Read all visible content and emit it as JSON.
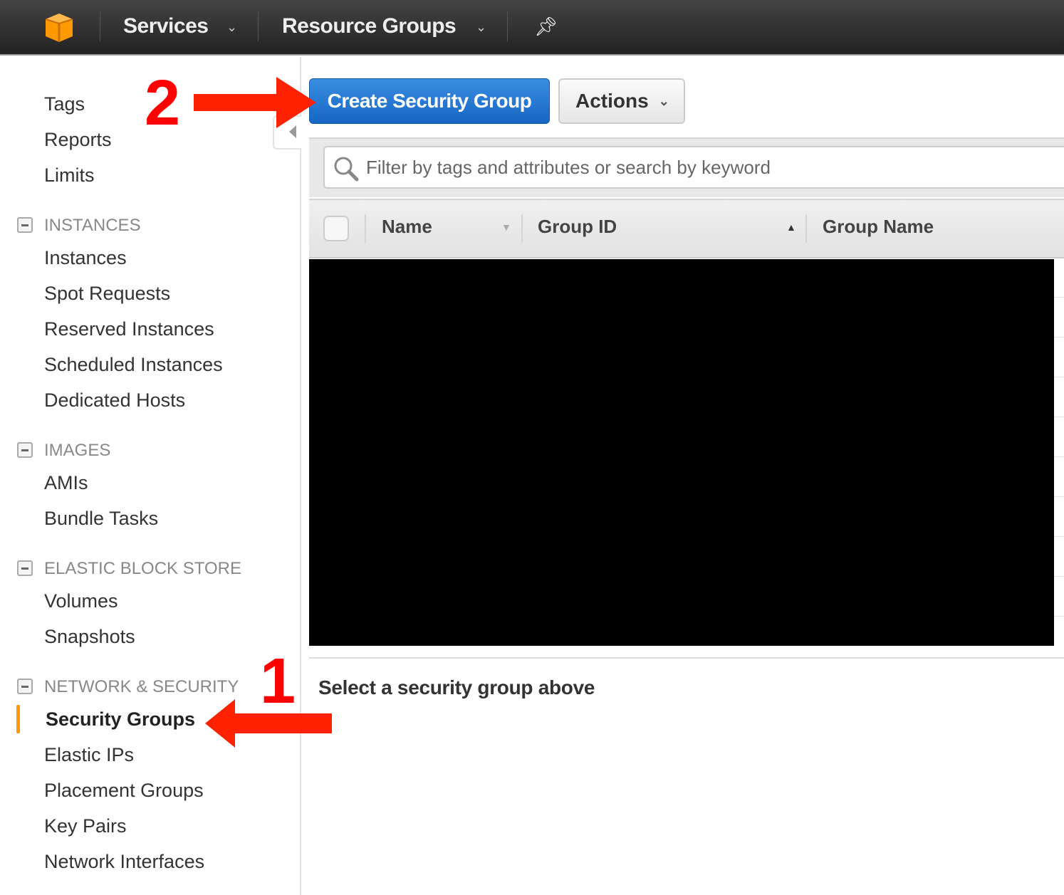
{
  "topbar": {
    "logo": "aws-cube-logo",
    "services_label": "Services",
    "resource_groups_label": "Resource Groups",
    "pin_icon": "pin-icon"
  },
  "sidebar": {
    "top_items": [
      "Tags",
      "Reports",
      "Limits"
    ],
    "sections": [
      {
        "header": "INSTANCES",
        "items": [
          "Instances",
          "Spot Requests",
          "Reserved Instances",
          "Scheduled Instances",
          "Dedicated Hosts"
        ]
      },
      {
        "header": "IMAGES",
        "items": [
          "AMIs",
          "Bundle Tasks"
        ]
      },
      {
        "header": "ELASTIC BLOCK STORE",
        "items": [
          "Volumes",
          "Snapshots"
        ]
      },
      {
        "header": "NETWORK & SECURITY",
        "items": [
          "Security Groups",
          "Elastic IPs",
          "Placement Groups",
          "Key Pairs",
          "Network Interfaces"
        ]
      }
    ],
    "active_item": "Security Groups",
    "accent_color": "#ff9900"
  },
  "toolbar": {
    "create_label": "Create Security Group",
    "actions_label": "Actions"
  },
  "search": {
    "placeholder": "Filter by tags and attributes or search by keyword"
  },
  "table": {
    "columns": [
      "Name",
      "Group ID",
      "Group Name"
    ]
  },
  "detail": {
    "empty_text": "Select a security group above"
  },
  "annotations": {
    "step1": "1",
    "step2": "2",
    "color": "#ff0000"
  }
}
